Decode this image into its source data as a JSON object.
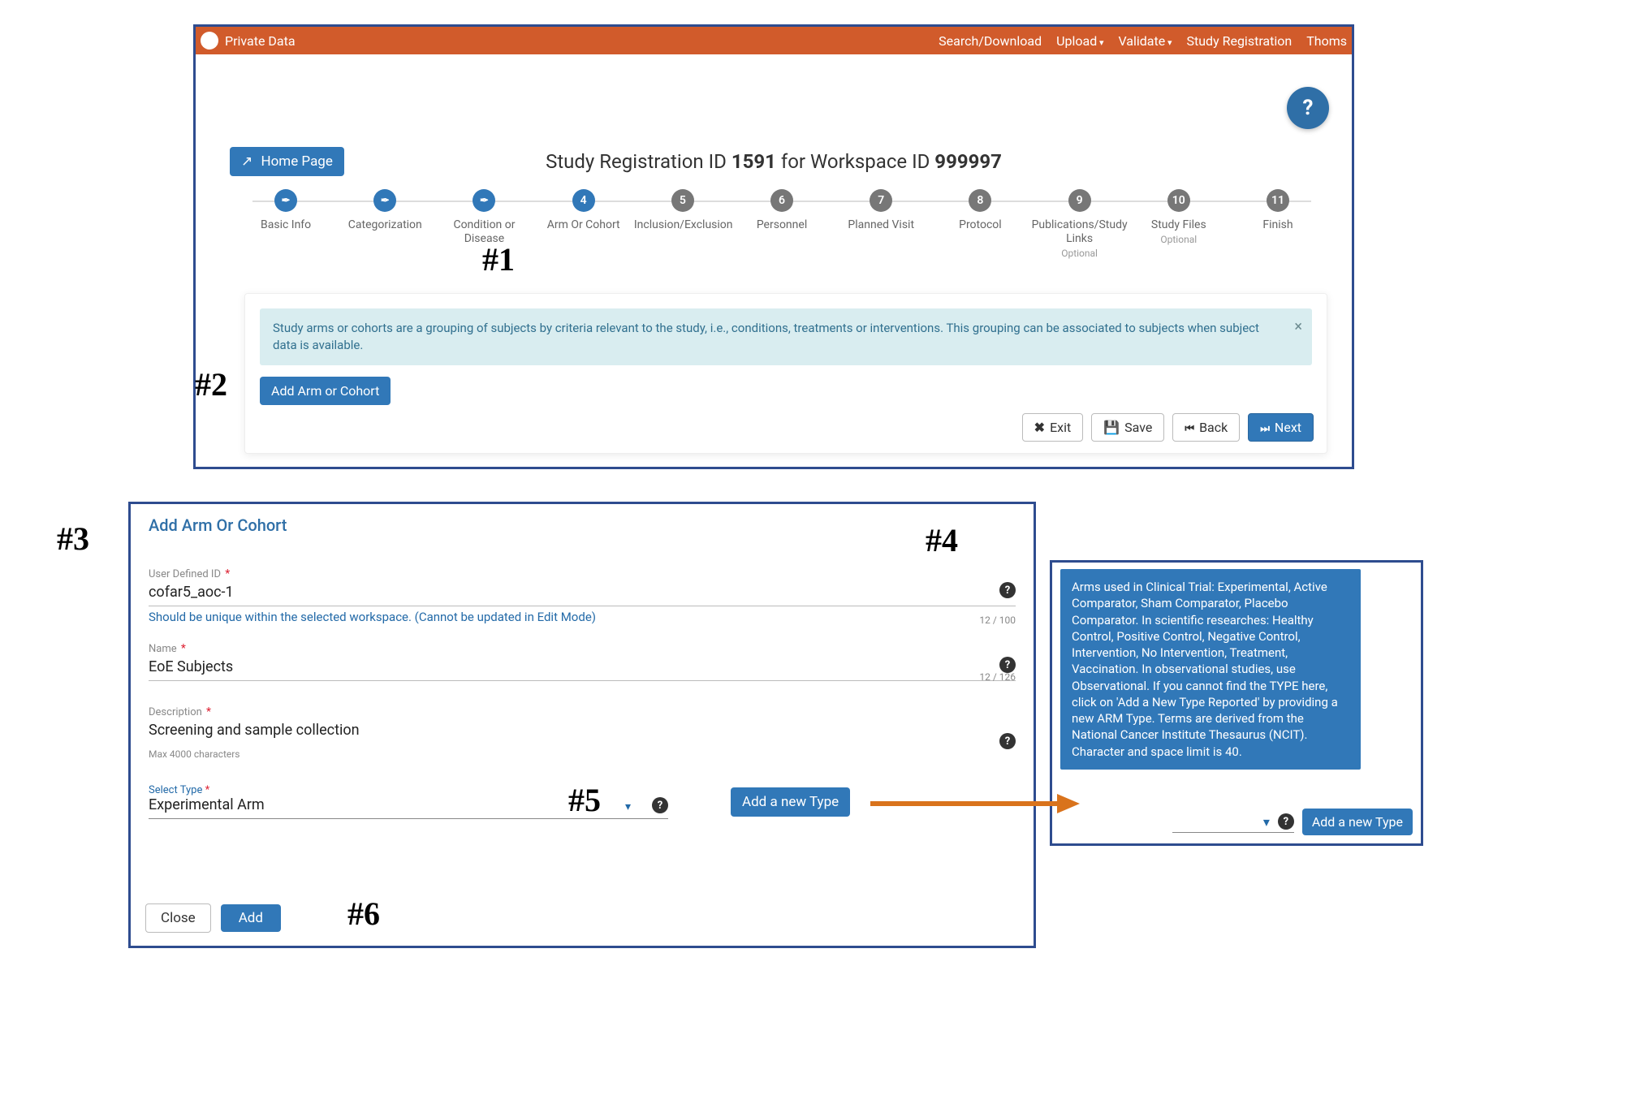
{
  "topbar": {
    "brand": "Private Data",
    "links": [
      "Search/Download",
      "Upload",
      "Validate",
      "Study Registration",
      "Thoms"
    ],
    "dropdown_idx": [
      1,
      2
    ]
  },
  "home_button": "Home Page",
  "title": {
    "prefix": "Study Registration ID ",
    "study_id": "1591",
    "mid": " for Workspace ID ",
    "workspace_id": "999997"
  },
  "steps": [
    {
      "label": "Basic Info",
      "state": "done"
    },
    {
      "label": "Categorization",
      "state": "done"
    },
    {
      "label": "Condition or Disease",
      "state": "done"
    },
    {
      "label": "Arm Or Cohort",
      "state": "active",
      "num": "4"
    },
    {
      "label": "Inclusion/Exclusion",
      "state": "pending",
      "num": "5"
    },
    {
      "label": "Personnel",
      "state": "pending",
      "num": "6"
    },
    {
      "label": "Planned Visit",
      "state": "pending",
      "num": "7"
    },
    {
      "label": "Protocol",
      "state": "pending",
      "num": "8"
    },
    {
      "label": "Publications/Study Links",
      "state": "pending",
      "num": "9",
      "optional": true
    },
    {
      "label": "Study Files",
      "state": "pending",
      "num": "10",
      "optional": true
    },
    {
      "label": "Finish",
      "state": "pending",
      "num": "11"
    }
  ],
  "alert_text": "Study arms or cohorts are a grouping of subjects by criteria relevant to the study, i.e., conditions, treatments or interventions. This grouping can be associated to subjects when subject data is available.",
  "add_arm_label": "Add Arm or Cohort",
  "footer": {
    "exit": "Exit",
    "save": "Save",
    "back": "Back",
    "next": "Next"
  },
  "modal": {
    "title": "Add Arm Or Cohort",
    "user_id_label": "User Defined ID",
    "user_id_value": "cofar5_aoc-1",
    "user_id_hint": "Should be unique within the selected workspace. (Cannot be updated in Edit Mode)",
    "user_id_counter": "12 / 100",
    "name_label": "Name",
    "name_value": "EoE Subjects",
    "name_counter": "12 / 126",
    "desc_label": "Description",
    "desc_value": "Screening and sample collection",
    "desc_note": "Max 4000 characters",
    "select_label": "Select Type",
    "select_value": "Experimental Arm",
    "add_type": "Add a new Type",
    "close": "Close",
    "add": "Add"
  },
  "tooltip_text": "Arms used in Clinical Trial: Experimental, Active Comparator, Sham Comparator, Placebo Comparator. In scientific researches: Healthy Control, Positive Control, Negative Control, Intervention, No Intervention, Treatment, Vaccination. In observational studies, use Observational. If you cannot find the TYPE here, click on 'Add a New Type Reported' by providing a new ARM Type. Terms are derived from the National Cancer Institute Thesaurus (NCIT). Character and space limit is 40.",
  "tooltip_add_type": "Add a new Type",
  "annotations": {
    "a1": "#1",
    "a2": "#2",
    "a3": "#3",
    "a4": "#4",
    "a5": "#5",
    "a6": "#6"
  },
  "optional_text": "Optional",
  "req_star": "*"
}
